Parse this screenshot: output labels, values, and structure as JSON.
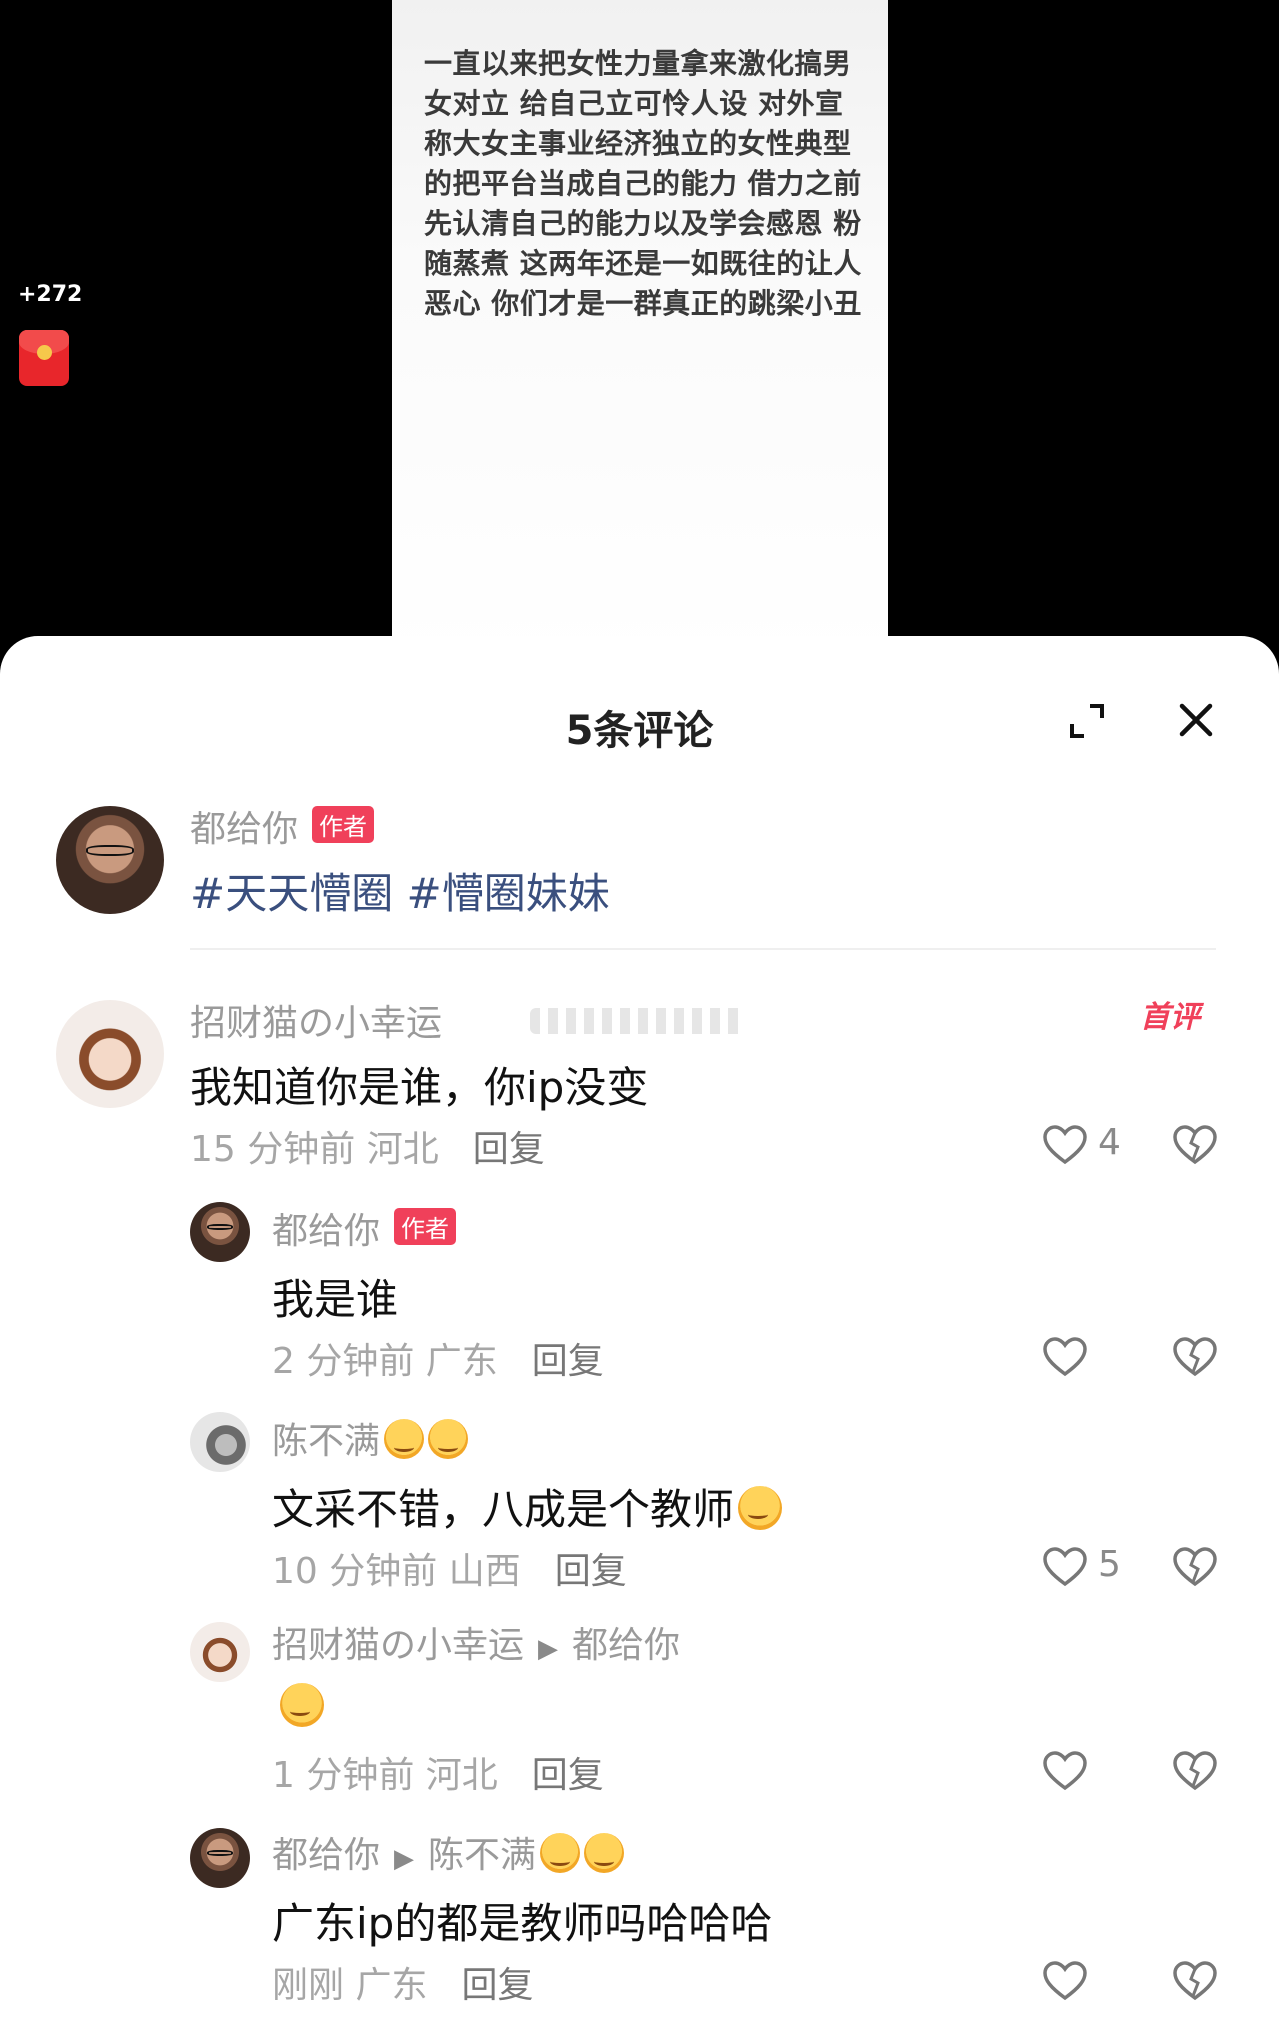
{
  "post": {
    "text": "一直以来把女性力量拿来激化搞男女对立 给自己立可怜人设 对外宣称大女主事业经济独立的女性典型的把平台当成自己的能力 借力之前先认清自己的能力以及学会感恩 粉随蒸煮 这两年还是一如既往的让人恶心 你们才是一群真正的跳梁小丑",
    "side_count": "+272"
  },
  "sheet": {
    "title": "5条评论"
  },
  "author_post": {
    "name": "都给你",
    "tag": "作者",
    "text": "#天天懵圈 #懵圈妹妹"
  },
  "comments": [
    {
      "name": "招财猫の小幸运",
      "badge": "首评",
      "text": "我知道你是谁，你ip没变",
      "time": "15 分钟前 河北",
      "reply": "回复",
      "likes": "4"
    },
    {
      "name": "都给你",
      "tag": "作者",
      "text": "我是谁",
      "time": "2 分钟前 广东",
      "reply": "回复"
    },
    {
      "name": "陈不满",
      "text": "文采不错，八成是个教师",
      "time": "10 分钟前 山西",
      "reply": "回复",
      "likes": "5"
    },
    {
      "name": "招财猫の小幸运",
      "reply_to": "都给你",
      "time": "1 分钟前 河北",
      "reply": "回复"
    },
    {
      "name": "都给你",
      "reply_to": "陈不满",
      "text": "广东ip的都是教师吗哈哈哈",
      "time": "刚刚 广东",
      "reply": "回复"
    }
  ],
  "colors": {
    "author_tag": "#f0405a",
    "hashtag": "#3a4f7e",
    "meta": "#a6a6a6"
  },
  "icons": [
    "expand-icon",
    "close-icon",
    "heart-icon",
    "dislike-heart-icon",
    "red-packet-icon"
  ]
}
